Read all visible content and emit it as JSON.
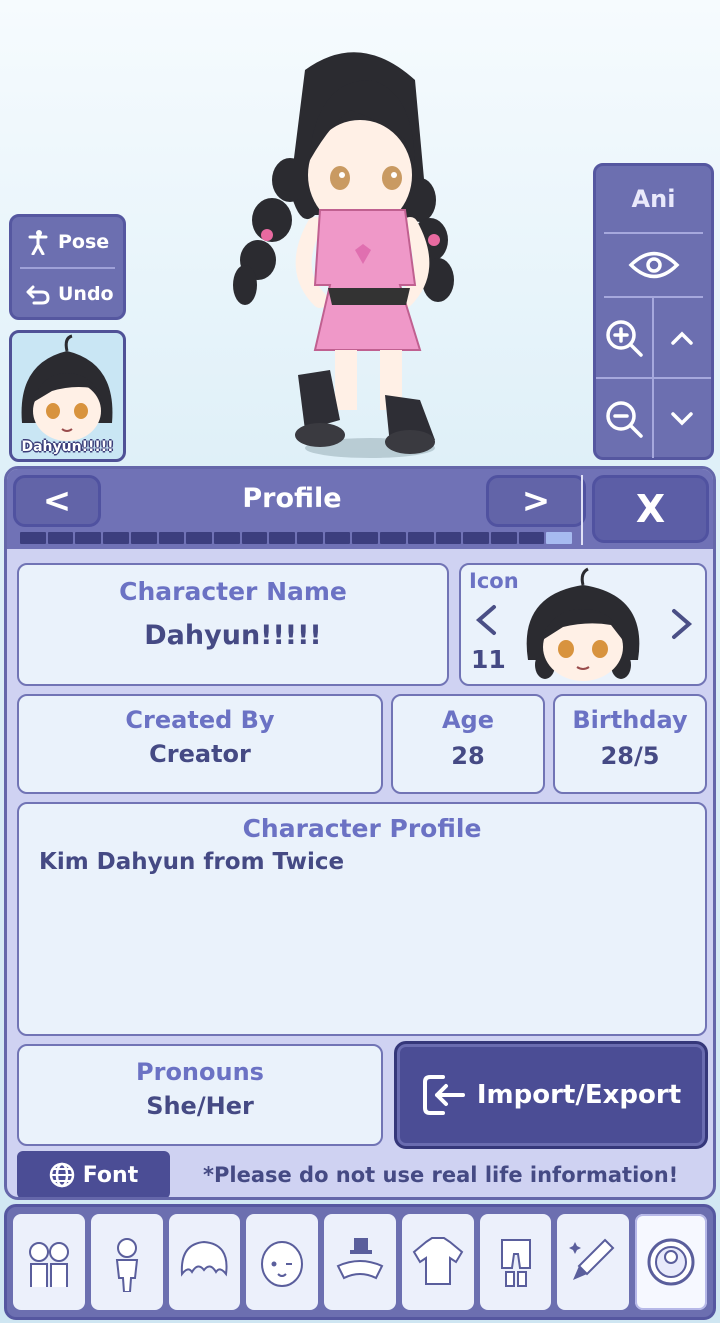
{
  "stage": {
    "pose_label": "Pose",
    "undo_label": "Undo",
    "character_slot_name": "Dahyun!!!!!",
    "ani_label": "Ani"
  },
  "profile": {
    "title": "Profile",
    "prev_symbol": "<",
    "next_symbol": ">",
    "close_symbol": "X",
    "progress_total": 20,
    "progress_current": 20,
    "character_name_label": "Character Name",
    "character_name": "Dahyun!!!!!",
    "icon_label": "Icon",
    "icon_number": "11",
    "created_by_label": "Created By",
    "created_by": "Creator",
    "age_label": "Age",
    "age": "28",
    "birthday_label": "Birthday",
    "birthday": "28/5",
    "character_profile_label": "Character Profile",
    "character_profile": "Kim Dahyun from Twice",
    "pronouns_label": "Pronouns",
    "pronouns": "She/Her",
    "import_export_label": "Import/Export",
    "font_label": "Font",
    "notice": "*Please do not use real life information!"
  },
  "toolbar": {
    "items": [
      {
        "icon": "characters-icon"
      },
      {
        "icon": "body-icon"
      },
      {
        "icon": "hair-icon"
      },
      {
        "icon": "face-icon"
      },
      {
        "icon": "accessories-icon"
      },
      {
        "icon": "top-icon"
      },
      {
        "icon": "bottom-icon"
      },
      {
        "icon": "props-icon"
      },
      {
        "icon": "profile-icon",
        "active": true
      }
    ]
  },
  "colors": {
    "panel_header": "#7072b6",
    "panel_bg": "#cfd2f2",
    "card_bg": "#eaf2fb",
    "title_text": "#6b72c4",
    "value_text": "#454a84",
    "button_dark": "#4b4d95"
  }
}
